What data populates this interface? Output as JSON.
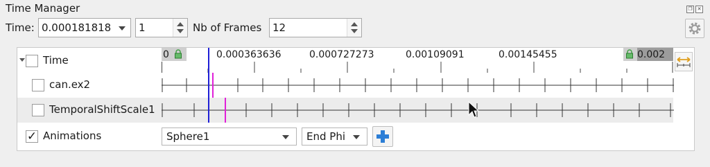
{
  "panel": {
    "title": "Time Manager"
  },
  "toolbar": {
    "time_label": "Time:",
    "time_value": "0.000181818",
    "timestep_value": "1",
    "frames_label": "Nb of Frames",
    "frames_value": "12"
  },
  "timeline": {
    "start": "0",
    "end": "0.002",
    "ticks": [
      "0.000363636",
      "0.000727273",
      "0.00109091",
      "0.00145455"
    ]
  },
  "rows": {
    "time": {
      "label": "Time"
    },
    "can": {
      "label": "can.ex2"
    },
    "shift": {
      "label": "TemporalShiftScale1"
    },
    "animations": {
      "label": "Animations",
      "checked": "✓"
    }
  },
  "animation_controls": {
    "source": "Sphere1",
    "property": "End Phi"
  },
  "colors": {
    "current_time": "#1f1fd6",
    "source_time": "#e020d8",
    "add": "#2c7ed6"
  },
  "icons": [
    "restore-icon",
    "close-icon",
    "gear-icon",
    "lock-icon",
    "expand-horizontal-icon",
    "plus-icon",
    "cursor-icon"
  ]
}
